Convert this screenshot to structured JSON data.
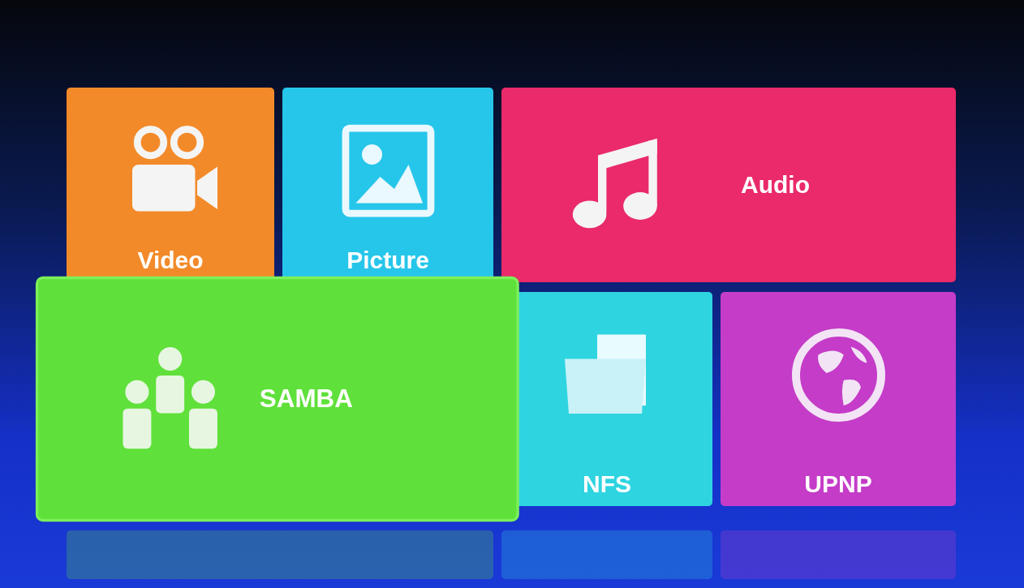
{
  "tiles": [
    {
      "label": "Video",
      "kind": "square",
      "color": "#f38a2a",
      "selected": false
    },
    {
      "label": "Picture",
      "kind": "square",
      "color": "#26c6ea",
      "selected": false
    },
    {
      "label": "Audio",
      "kind": "wide",
      "color": "#ea2a6a",
      "selected": false
    },
    {
      "label": "SAMBA",
      "kind": "wide",
      "color": "#5fe03a",
      "selected": true
    },
    {
      "label": "NFS",
      "kind": "square",
      "color": "#2ed4e0",
      "selected": false
    },
    {
      "label": "UPNP",
      "kind": "square",
      "color": "#c43cc8",
      "selected": false
    }
  ]
}
